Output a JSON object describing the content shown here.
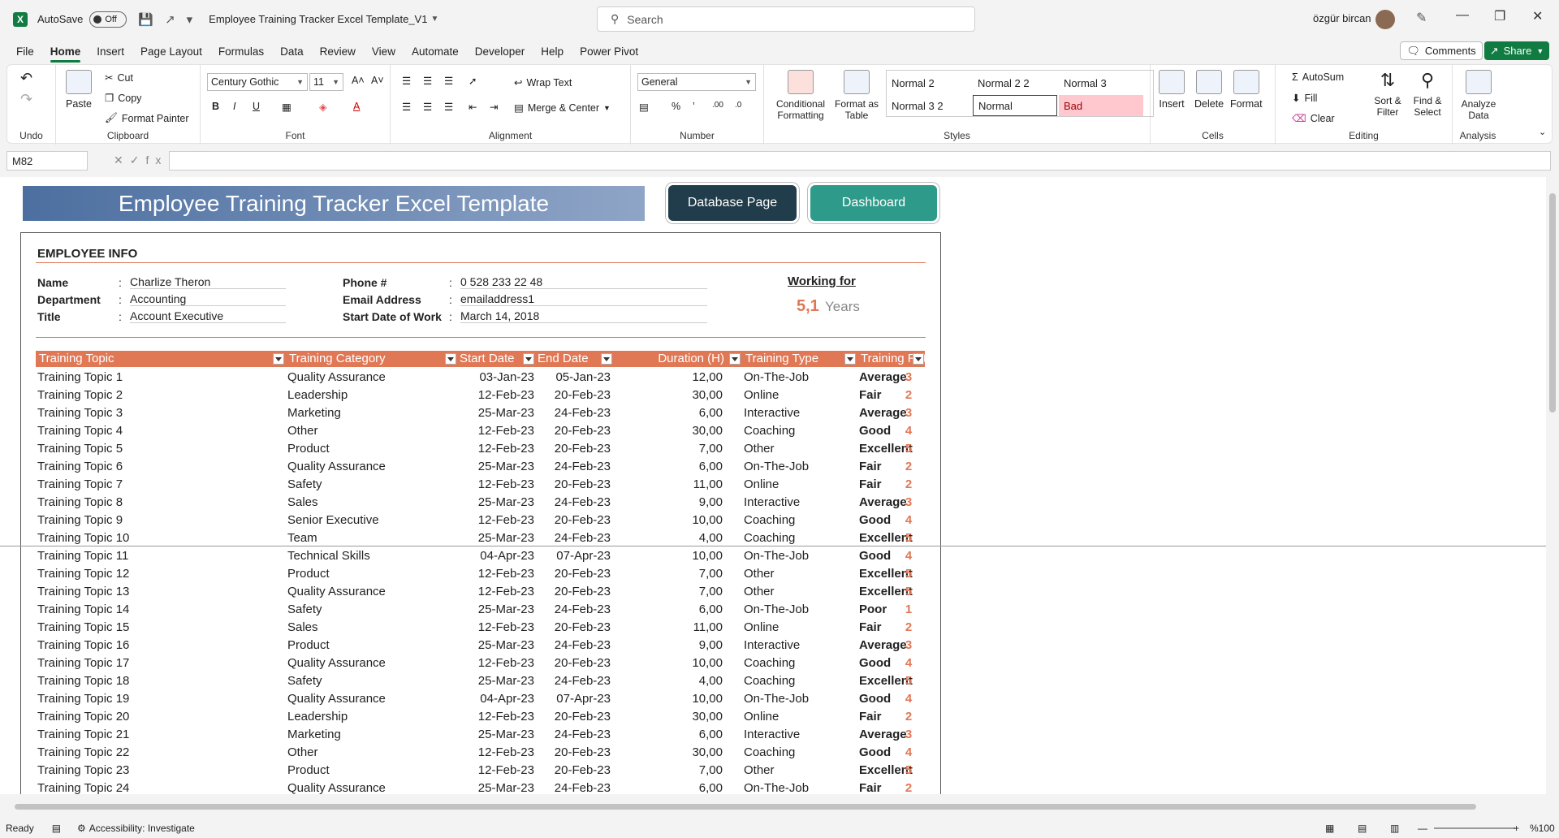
{
  "titlebar": {
    "autosave_label": "AutoSave",
    "autosave_state": "Off",
    "doc_title": "Employee Training Tracker Excel Template_V1",
    "search_placeholder": "Search",
    "user_name": "özgür bircan"
  },
  "menu": [
    "File",
    "Home",
    "Insert",
    "Page Layout",
    "Formulas",
    "Data",
    "Review",
    "View",
    "Automate",
    "Developer",
    "Help",
    "Power Pivot"
  ],
  "active_menu": "Home",
  "comments_label": "Comments",
  "share_label": "Share",
  "ribbon": {
    "undo_label": "Undo",
    "clipboard": {
      "paste": "Paste",
      "cut": "Cut",
      "copy": "Copy",
      "format_painter": "Format Painter",
      "label": "Clipboard"
    },
    "font": {
      "name": "Century Gothic",
      "size": "11",
      "label": "Font",
      "bold": "B",
      "italic": "I",
      "underline": "U"
    },
    "alignment": {
      "wrap": "Wrap Text",
      "merge": "Merge & Center",
      "label": "Alignment"
    },
    "number": {
      "format": "General",
      "label": "Number"
    },
    "styles": {
      "cond_format": "Conditional Formatting",
      "format_table": "Format as Table",
      "cells": [
        "Normal 2",
        "Normal 2 2",
        "Normal 3",
        "Normal 3 2",
        "Normal",
        "Bad"
      ],
      "label": "Styles"
    },
    "cells": {
      "insert": "Insert",
      "delete": "Delete",
      "format": "Format",
      "label": "Cells"
    },
    "editing": {
      "autosum": "AutoSum",
      "fill": "Fill",
      "clear": "Clear",
      "sort": "Sort & Filter",
      "find": "Find & Select",
      "label": "Editing"
    },
    "analysis": {
      "analyze": "Analyze Data",
      "label": "Analysis"
    }
  },
  "namebox": "M82",
  "sheet": {
    "banner": "Employee Training Tracker Excel Template",
    "database_btn": "Database Page",
    "dashboard_btn": "Dashboard",
    "section_title": "EMPLOYEE INFO",
    "info": {
      "name_label": "Name",
      "name": "Charlize Theron",
      "dept_label": "Department",
      "dept": "Accounting",
      "title_label": "Title",
      "title": "Account Executive",
      "phone_label": "Phone #",
      "phone": "0 528 233 22 48",
      "email_label": "Email Address",
      "email": "emailaddress1",
      "start_label": "Start Date of Work",
      "start": "March 14, 2018"
    },
    "working_for": "Working for",
    "years_num": "5,1",
    "years_txt": "Years",
    "headers": [
      "Training Topic",
      "Training Category",
      "Start Date",
      "End Date",
      "Duration (H)",
      "Training Type",
      "Training Rating"
    ],
    "rows": [
      [
        "Training Topic 1",
        "Quality Assurance",
        "03-Jan-23",
        "05-Jan-23",
        "12,00",
        "On-The-Job",
        "Average",
        "3"
      ],
      [
        "Training Topic 2",
        "Leadership",
        "12-Feb-23",
        "20-Feb-23",
        "30,00",
        "Online",
        "Fair",
        "2"
      ],
      [
        "Training Topic 3",
        "Marketing",
        "25-Mar-23",
        "24-Feb-23",
        "6,00",
        "Interactive",
        "Average",
        "3"
      ],
      [
        "Training Topic 4",
        "Other",
        "12-Feb-23",
        "20-Feb-23",
        "30,00",
        "Coaching",
        "Good",
        "4"
      ],
      [
        "Training Topic 5",
        "Product",
        "12-Feb-23",
        "20-Feb-23",
        "7,00",
        "Other",
        "Excellent",
        "5"
      ],
      [
        "Training Topic 6",
        "Quality Assurance",
        "25-Mar-23",
        "24-Feb-23",
        "6,00",
        "On-The-Job",
        "Fair",
        "2"
      ],
      [
        "Training Topic 7",
        "Safety",
        "12-Feb-23",
        "20-Feb-23",
        "11,00",
        "Online",
        "Fair",
        "2"
      ],
      [
        "Training Topic 8",
        "Sales",
        "25-Mar-23",
        "24-Feb-23",
        "9,00",
        "Interactive",
        "Average",
        "3"
      ],
      [
        "Training Topic 9",
        "Senior Executive",
        "12-Feb-23",
        "20-Feb-23",
        "10,00",
        "Coaching",
        "Good",
        "4"
      ],
      [
        "Training Topic 10",
        "Team",
        "25-Mar-23",
        "24-Feb-23",
        "4,00",
        "Coaching",
        "Excellent",
        "5"
      ],
      [
        "Training Topic 11",
        "Technical Skills",
        "04-Apr-23",
        "07-Apr-23",
        "10,00",
        "On-The-Job",
        "Good",
        "4"
      ],
      [
        "Training Topic 12",
        "Product",
        "12-Feb-23",
        "20-Feb-23",
        "7,00",
        "Other",
        "Excellent",
        "5"
      ],
      [
        "Training Topic 13",
        "Quality Assurance",
        "12-Feb-23",
        "20-Feb-23",
        "7,00",
        "Other",
        "Excellent",
        "5"
      ],
      [
        "Training Topic 14",
        "Safety",
        "25-Mar-23",
        "24-Feb-23",
        "6,00",
        "On-The-Job",
        "Poor",
        "1"
      ],
      [
        "Training Topic 15",
        "Sales",
        "12-Feb-23",
        "20-Feb-23",
        "11,00",
        "Online",
        "Fair",
        "2"
      ],
      [
        "Training Topic 16",
        "Product",
        "25-Mar-23",
        "24-Feb-23",
        "9,00",
        "Interactive",
        "Average",
        "3"
      ],
      [
        "Training Topic 17",
        "Quality Assurance",
        "12-Feb-23",
        "20-Feb-23",
        "10,00",
        "Coaching",
        "Good",
        "4"
      ],
      [
        "Training Topic 18",
        "Safety",
        "25-Mar-23",
        "24-Feb-23",
        "4,00",
        "Coaching",
        "Excellent",
        "5"
      ],
      [
        "Training Topic 19",
        "Quality Assurance",
        "04-Apr-23",
        "07-Apr-23",
        "10,00",
        "On-The-Job",
        "Good",
        "4"
      ],
      [
        "Training Topic 20",
        "Leadership",
        "12-Feb-23",
        "20-Feb-23",
        "30,00",
        "Online",
        "Fair",
        "2"
      ],
      [
        "Training Topic 21",
        "Marketing",
        "25-Mar-23",
        "24-Feb-23",
        "6,00",
        "Interactive",
        "Average",
        "3"
      ],
      [
        "Training Topic 22",
        "Other",
        "12-Feb-23",
        "20-Feb-23",
        "30,00",
        "Coaching",
        "Good",
        "4"
      ],
      [
        "Training Topic 23",
        "Product",
        "12-Feb-23",
        "20-Feb-23",
        "7,00",
        "Other",
        "Excellent",
        "5"
      ],
      [
        "Training Topic 24",
        "Quality Assurance",
        "25-Mar-23",
        "24-Feb-23",
        "6,00",
        "On-The-Job",
        "Fair",
        "2"
      ]
    ]
  },
  "status": {
    "ready": "Ready",
    "accessibility": "Accessibility: Investigate",
    "zoom": "%100"
  }
}
